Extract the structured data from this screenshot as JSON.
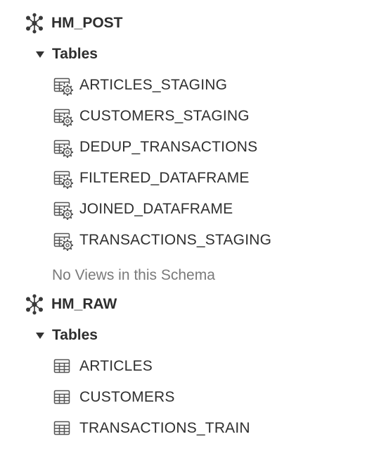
{
  "schemas": [
    {
      "name": "HM_POST",
      "icon": "schema-network-icon",
      "group_label": "Tables",
      "group_expanded": true,
      "tables": [
        {
          "label": "ARTICLES_STAGING",
          "icon": "dynamic-table-icon"
        },
        {
          "label": "CUSTOMERS_STAGING",
          "icon": "dynamic-table-icon"
        },
        {
          "label": "DEDUP_TRANSACTIONS",
          "icon": "dynamic-table-icon"
        },
        {
          "label": "FILTERED_DATAFRAME",
          "icon": "dynamic-table-icon"
        },
        {
          "label": "JOINED_DATAFRAME",
          "icon": "dynamic-table-icon"
        },
        {
          "label": "TRANSACTIONS_STAGING",
          "icon": "dynamic-table-icon"
        }
      ],
      "views_message": "No Views in this Schema"
    },
    {
      "name": "HM_RAW",
      "icon": "schema-network-icon",
      "group_label": "Tables",
      "group_expanded": true,
      "tables": [
        {
          "label": "ARTICLES",
          "icon": "table-icon"
        },
        {
          "label": "CUSTOMERS",
          "icon": "table-icon"
        },
        {
          "label": "TRANSACTIONS_TRAIN",
          "icon": "table-icon"
        }
      ]
    }
  ],
  "colors": {
    "text": "#2f2f2f",
    "muted_text": "#7a7a7a",
    "icon": "#4a4a4a"
  }
}
